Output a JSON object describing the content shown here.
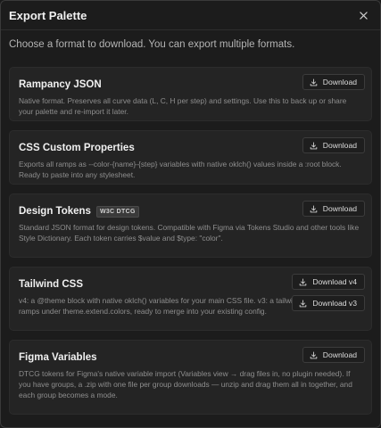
{
  "dialog": {
    "title": "Export Palette",
    "intro": "Choose a format to download. You can export multiple formats."
  },
  "formats": [
    {
      "title": "Rampancy JSON",
      "badge": "",
      "description": "Native format. Preserves all curve data (L, C, H per step) and settings. Use this to back up or share your palette and re-import it later.",
      "buttons": [
        "Download"
      ]
    },
    {
      "title": "CSS Custom Properties",
      "badge": "",
      "description": "Exports all ramps as --color-{name}-{step} variables with native oklch() values inside a :root block. Ready to paste into any stylesheet.",
      "buttons": [
        "Download"
      ]
    },
    {
      "title": "Design Tokens",
      "badge": "W3C DTCG",
      "description": "Standard JSON format for design tokens. Compatible with Figma via Tokens Studio and other tools like Style Dictionary. Each token carries $value and $type: \"color\".",
      "buttons": [
        "Download"
      ]
    },
    {
      "title": "Tailwind CSS",
      "badge": "",
      "description": "v4: a @theme block with native oklch() variables for your main CSS file. v3: a tailwind.config.js with all ramps under theme.extend.colors, ready to merge into your existing config.",
      "buttons": [
        "Download v4",
        "Download v3"
      ]
    },
    {
      "title": "Figma Variables",
      "badge": "",
      "description": "DTCG tokens for Figma's native variable import (Variables view → drag files in, no plugin needed). If you have groups, a .zip with one file per group downloads — unzip and drag them all in together, and each group becomes a mode.",
      "buttons": [
        "Download"
      ]
    }
  ],
  "colors": {
    "background": "#1c1c1c",
    "card": "#242424",
    "text": "#f0f0f0",
    "muted": "#8e8e8e"
  },
  "icons": {
    "close": "close-icon",
    "download": "download-icon"
  }
}
